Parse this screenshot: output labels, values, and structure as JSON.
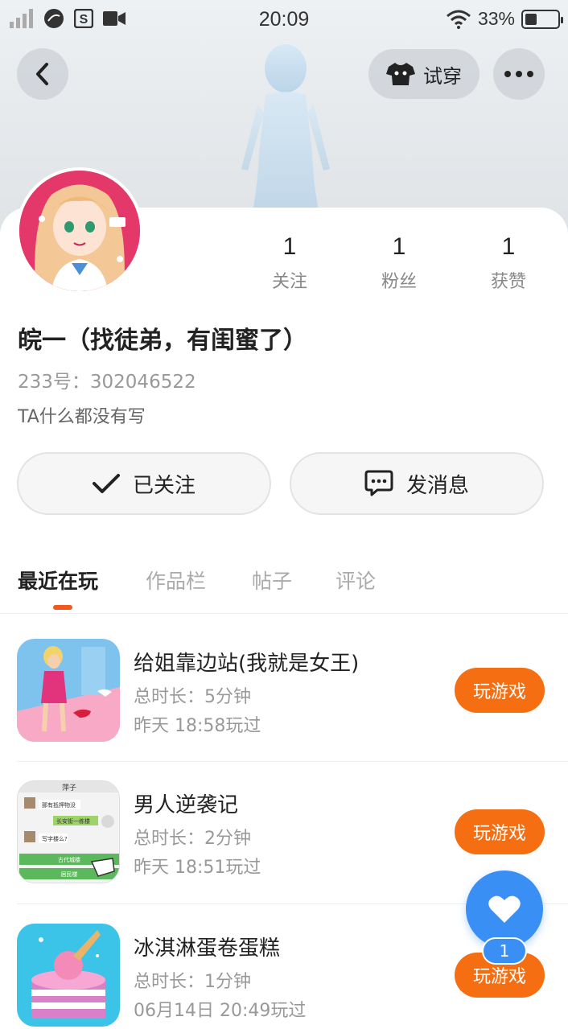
{
  "status_bar": {
    "time": "20:09",
    "battery": "33%"
  },
  "header": {
    "tryon_label": "试穿"
  },
  "profile": {
    "nickname": "皖一（找徒弟，有闺蜜了）",
    "uid": "233号：302046522",
    "bio": "TA什么都没有写"
  },
  "stats": [
    {
      "value": "1",
      "label": "关注"
    },
    {
      "value": "1",
      "label": "粉丝"
    },
    {
      "value": "1",
      "label": "获赞"
    }
  ],
  "actions": {
    "follow_label": "已关注",
    "message_label": "发消息"
  },
  "tabs": [
    "最近在玩",
    "作品栏",
    "帖子",
    "评论"
  ],
  "games": [
    {
      "name": "给姐靠边站(我就是女王)",
      "duration": "总时长：5分钟",
      "last_played": "昨天 18:58玩过",
      "play_label": "玩游戏"
    },
    {
      "name": "男人逆袭记",
      "duration": "总时长：2分钟",
      "last_played": "昨天 18:51玩过",
      "play_label": "玩游戏"
    },
    {
      "name": "冰淇淋蛋卷蛋糕",
      "duration": "总时长：1分钟",
      "last_played": "06月14日 20:49玩过",
      "play_label": "玩游戏"
    }
  ],
  "game2_icon_text": {
    "title": "萍子",
    "chat1": "那有抵押物没",
    "chat2": "长安街一栋楼",
    "chat3": "写字楼么?",
    "opt1": "古代城楼",
    "opt2": "居民楼"
  },
  "like": {
    "count": "1"
  },
  "colors": {
    "accent": "#f56f12",
    "indicator": "#f25a1d",
    "like_blue": "#3a8ff5"
  }
}
